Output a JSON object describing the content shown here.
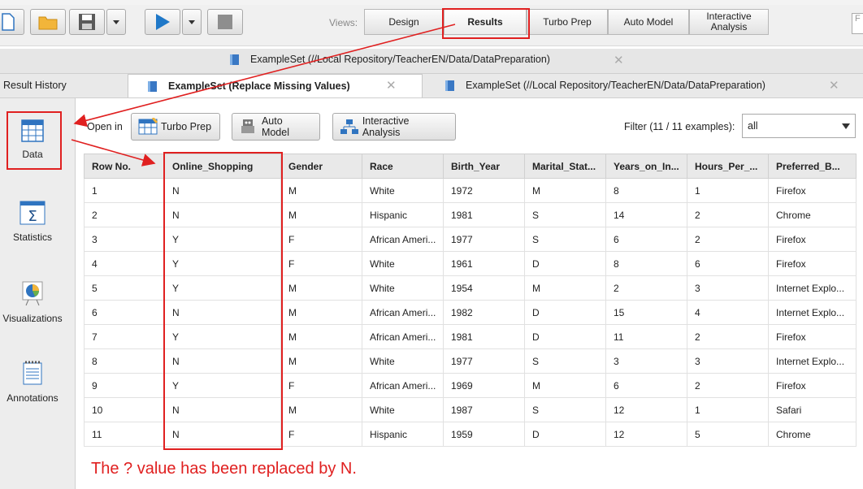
{
  "toolbar": {
    "views_label": "Views:",
    "view_tabs": [
      "Design",
      "Results",
      "Turbo Prep",
      "Auto Model",
      "Interactive\nAnalysis"
    ],
    "search_placeholder": "F"
  },
  "tabs_row1": [
    {
      "label": "ExampleSet (//Local Repository/TeacherEN/Data/DataPreparation)"
    }
  ],
  "tabs_row2": {
    "history_label": "Result History",
    "tabs": [
      {
        "label": "ExampleSet (Replace Missing Values)",
        "active": true
      },
      {
        "label": "ExampleSet (//Local Repository/TeacherEN/Data/DataPreparation)",
        "active": false
      }
    ]
  },
  "sidebar": {
    "items": [
      {
        "label": "Data"
      },
      {
        "label": "Statistics"
      },
      {
        "label": "Visualizations"
      },
      {
        "label": "Annotations"
      }
    ]
  },
  "open_in": {
    "label": "Open in",
    "buttons": [
      "Turbo Prep",
      "Auto Model",
      "Interactive Analysis"
    ]
  },
  "filter": {
    "label": "Filter (11 / 11 examples):",
    "value": "all"
  },
  "table": {
    "columns": [
      "Row No.",
      "Online_Shopping",
      "Gender",
      "Race",
      "Birth_Year",
      "Marital_Stat...",
      "Years_on_In...",
      "Hours_Per_...",
      "Preferred_B..."
    ],
    "rows": [
      [
        "1",
        "N",
        "M",
        "White",
        "1972",
        "M",
        "8",
        "1",
        "Firefox"
      ],
      [
        "2",
        "N",
        "M",
        "Hispanic",
        "1981",
        "S",
        "14",
        "2",
        "Chrome"
      ],
      [
        "3",
        "Y",
        "F",
        "African Ameri...",
        "1977",
        "S",
        "6",
        "2",
        "Firefox"
      ],
      [
        "4",
        "Y",
        "F",
        "White",
        "1961",
        "D",
        "8",
        "6",
        "Firefox"
      ],
      [
        "5",
        "Y",
        "M",
        "White",
        "1954",
        "M",
        "2",
        "3",
        "Internet Explo..."
      ],
      [
        "6",
        "N",
        "M",
        "African Ameri...",
        "1982",
        "D",
        "15",
        "4",
        "Internet Explo..."
      ],
      [
        "7",
        "Y",
        "M",
        "African Ameri...",
        "1981",
        "D",
        "11",
        "2",
        "Firefox"
      ],
      [
        "8",
        "N",
        "M",
        "White",
        "1977",
        "S",
        "3",
        "3",
        "Internet Explo..."
      ],
      [
        "9",
        "Y",
        "F",
        "African Ameri...",
        "1969",
        "M",
        "6",
        "2",
        "Firefox"
      ],
      [
        "10",
        "N",
        "M",
        "White",
        "1987",
        "S",
        "12",
        "1",
        "Safari"
      ],
      [
        "11",
        "N",
        "F",
        "Hispanic",
        "1959",
        "D",
        "12",
        "5",
        "Chrome"
      ]
    ]
  },
  "annotation_note": "The ? value has been replaced by N.",
  "colors": {
    "annotation_red": "#e02020",
    "accent_blue": "#1f78c8"
  }
}
